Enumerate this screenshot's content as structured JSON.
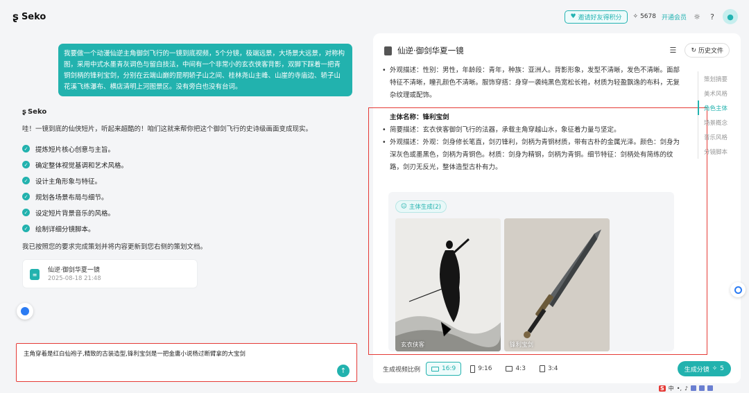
{
  "header": {
    "brand": "Seko",
    "invite_label": "邀请好友得积分",
    "points": "5678",
    "member_label": "开通会员"
  },
  "chat": {
    "user_message": "我要做一个动漫仙逆主角御剑飞行的一镜到底视频，5个分镜，极端远景，大场景大远景，对称构图，采用中式水墨青灰调色与留白技法，中间有一个非常小的玄衣侠客背影，双脚下踩着一把青铜剑柄的锋利宝剑，分别在云端山巅的昆明轿子山之间、桂林尧山主峰、山崖的寺庙边、轿子山花溪飞练瀑布、横店清明上河图景区。没有旁白也没有台词。",
    "ai_name": "Seko",
    "ai_intro": "哇！一镜到底的仙侠短片，听起来超酷的！咱们这就来帮你把这个御剑飞行的史诗级画面变成现实。",
    "steps": [
      "提炼短片核心创意与主旨。",
      "确定整体视觉基调和艺术风格。",
      "设计主角形象与特征。",
      "规划各场景布局与细节。",
      "设定短片背景音乐的风格。",
      "绘制详细分镜脚本。"
    ],
    "ai_done": "我已按照您的要求完成策划并将内容更新到您右侧的策划文档。",
    "doc_card": {
      "title": "仙逆·御剑华夏一镜",
      "time": "2025-08-18 21:48"
    },
    "input_value": "主角穿着是红白仙袍子,精致的古装造型,锋利宝剑是一把金庸小说杨过断臂拿的大宝剑"
  },
  "panel": {
    "title": "仙逆·御剑华夏一镜",
    "history_label": "历史文件",
    "appearance_top": "外观描述：性别：男性，年龄段：青年，种族：亚洲人。背影形象，发型不清晰，发色不清晰。面部特征不清晰，瞳孔颜色不清晰。服饰穿搭：身穿一袭纯黑色宽松长袍，材质为轻盈飘逸的布料，无复杂纹理或配饰。",
    "subject_title": "主体名称：锋利宝剑",
    "brief": "简要描述：玄衣侠客御剑飞行的法器，承载主角穿越山水，象征着力量与坚定。",
    "appearance": "外观描述：外观：剑身修长笔直，剑刃锋利，剑柄为青铜材质，带有古朴的金属光泽。颜色：剑身为深灰色或墨黑色，剑柄为青铜色。材质：剑身为精钢，剑柄为青铜。细节特征：剑柄处有简练的纹路，剑刃无反光，整体造型古朴有力。",
    "gen_tag": "主体生成(2)",
    "images": [
      {
        "label": "玄衣侠客"
      },
      {
        "label": "锋利宝剑"
      }
    ]
  },
  "toc": [
    "策划摘要",
    "美术风格",
    "角色主体",
    "场景概念",
    "音乐风格",
    "分镜脚本"
  ],
  "bottom": {
    "ratio_label": "生成视频比例",
    "ratios": [
      "16:9",
      "9:16",
      "4:3",
      "3:4"
    ],
    "generate_label": "生成分镜",
    "generate_cost": "5"
  },
  "tray": {
    "ime": "S",
    "lang": "中"
  },
  "colors": {
    "accent": "#22b2ae",
    "annotation": "#e53935"
  }
}
